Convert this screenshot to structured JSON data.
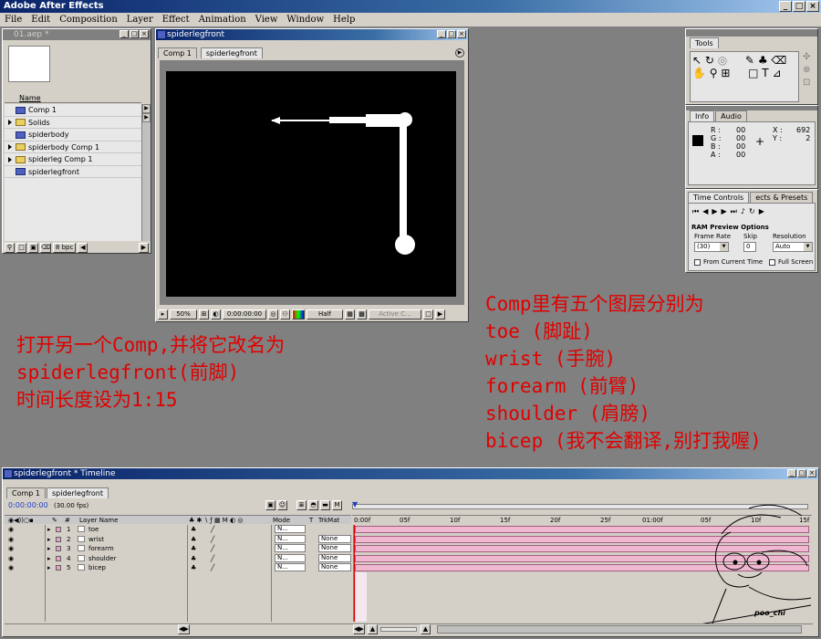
{
  "app": {
    "title": "Adobe After Effects"
  },
  "menu": [
    "File",
    "Edit",
    "Composition",
    "Layer",
    "Effect",
    "Animation",
    "View",
    "Window",
    "Help"
  ],
  "project": {
    "title": "01.aep *",
    "column_name": "Name",
    "items": [
      {
        "name": "Comp 1",
        "type": "comp",
        "expand": false
      },
      {
        "name": "Solids",
        "type": "folder",
        "expand": true
      },
      {
        "name": "spiderbody",
        "type": "comp",
        "expand": false
      },
      {
        "name": "spiderbody Comp 1",
        "type": "folder",
        "expand": true
      },
      {
        "name": "spiderleg Comp 1",
        "type": "folder",
        "expand": true
      },
      {
        "name": "spiderlegfront",
        "type": "comp",
        "expand": false
      }
    ],
    "bpc": "8 bpc"
  },
  "comp_window": {
    "title": "spiderlegfront",
    "tabs": [
      "Comp 1",
      "spiderlegfront"
    ],
    "zoom": "50%",
    "timecode": "0:00:00:00",
    "resolution": "Half",
    "camera": "Active C..."
  },
  "tools": {
    "title": "Tools"
  },
  "info": {
    "tabs": [
      "Info",
      "Audio"
    ],
    "r_label": "R :",
    "g_label": "G :",
    "b_label": "B :",
    "a_label": "A :",
    "r": "00",
    "g": "00",
    "b": "00",
    "a": "00",
    "x_label": "X :",
    "y_label": "Y :",
    "x": "692",
    "y": "2"
  },
  "time_controls": {
    "tabs": [
      "Time Controls",
      "ects & Presets"
    ],
    "ram_preview": "RAM Preview Options",
    "frame_rate_label": "Frame Rate",
    "skip_label": "Skip",
    "resolution_label": "Resolution",
    "frame_rate": "(30)",
    "skip": "0",
    "resolution": "Auto",
    "from_current": "From Current Time",
    "full_screen": "Full Screen"
  },
  "annotation_left": [
    "打开另一个Comp,并将它改名为",
    "spiderlegfront(前脚)",
    "时间长度设为1:15"
  ],
  "annotation_right": [
    "Comp里有五个图层分别为",
    "toe (脚趾)",
    "wrist (手腕)",
    "forearm (前臂)",
    "shoulder (肩膀)",
    "bicep (我不会翻译,别打我喔)"
  ],
  "timeline": {
    "title": "spiderlegfront * Timeline",
    "tabs": [
      "Comp 1",
      "spiderlegfront"
    ],
    "timecode": "0:00:00:00",
    "fps": "(30.00 fps)",
    "header": {
      "num": "#",
      "layer_name": "Layer Name",
      "mode": "Mode",
      "t": "T",
      "trkmat": "TrkMat"
    },
    "ruler": [
      "0:00f",
      "05f",
      "10f",
      "15f",
      "20f",
      "25f",
      "01:00f",
      "05f",
      "10f",
      "15f"
    ],
    "layers": [
      {
        "num": "1",
        "name": "toe",
        "mode": "N...",
        "trkmat": ""
      },
      {
        "num": "2",
        "name": "wrist",
        "mode": "N...",
        "trkmat": "None"
      },
      {
        "num": "3",
        "name": "forearm",
        "mode": "N...",
        "trkmat": "None"
      },
      {
        "num": "4",
        "name": "shoulder",
        "mode": "N...",
        "trkmat": "None"
      },
      {
        "num": "5",
        "name": "bicep",
        "mode": "N...",
        "trkmat": "None"
      }
    ],
    "signature": "poo_chi"
  }
}
